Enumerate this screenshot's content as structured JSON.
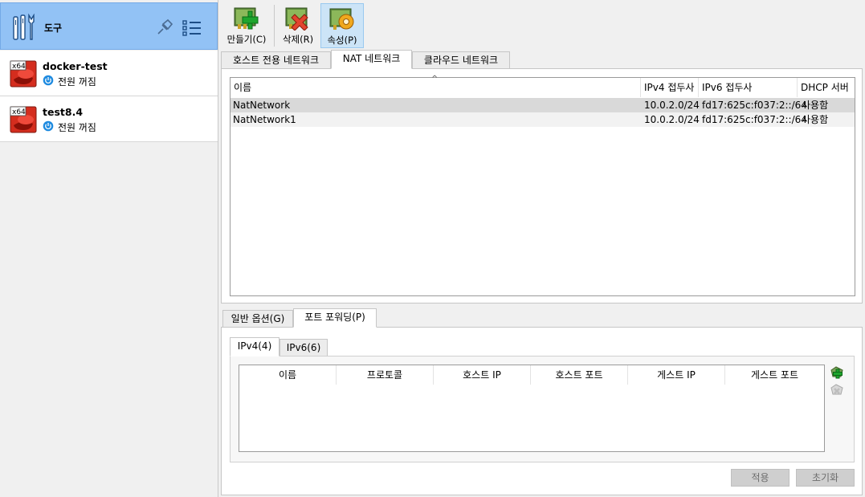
{
  "sidebar": {
    "tools_label": "도구",
    "vms": [
      {
        "name": "docker-test",
        "os_badge": "x64",
        "state": "전원 꺼짐"
      },
      {
        "name": "test8.4",
        "os_badge": "x64",
        "state": "전원 꺼짐"
      }
    ]
  },
  "toolbar": {
    "create_label": "만들기(C)",
    "delete_label": "삭제(R)",
    "properties_label": "속성(P)"
  },
  "network_tabs": [
    "호스트 전용 네트워크",
    "NAT 네트워크",
    "클라우드 네트워크"
  ],
  "network_table": {
    "columns": [
      "이름",
      "IPv4 접두사",
      "IPv6 접두사",
      "DHCP 서버"
    ],
    "sort_indicator": "^",
    "rows": [
      {
        "name": "NatNetwork",
        "ipv4": "10.0.2.0/24",
        "ipv6": "fd17:625c:f037:2::/64",
        "dhcp": "사용함"
      },
      {
        "name": "NatNetwork1",
        "ipv4": "10.0.2.0/24",
        "ipv6": "fd17:625c:f037:2::/64",
        "dhcp": "사용함"
      }
    ]
  },
  "detail_tabs": [
    "일반 옵션(G)",
    "포트 포워딩(P)"
  ],
  "ip_tabs": [
    "IPv4(4)",
    "IPv6(6)"
  ],
  "rules_table": {
    "columns": [
      "이름",
      "프로토콜",
      "호스트 IP",
      "호스트 포트",
      "게스트 IP",
      "게스트 포트"
    ]
  },
  "buttons": {
    "apply": "적용",
    "reset": "초기화"
  },
  "colors": {
    "tools_header_bg": "#92c2f5",
    "selected_row": "#d9d9d9",
    "active_toolbar": "#cce4f7"
  }
}
